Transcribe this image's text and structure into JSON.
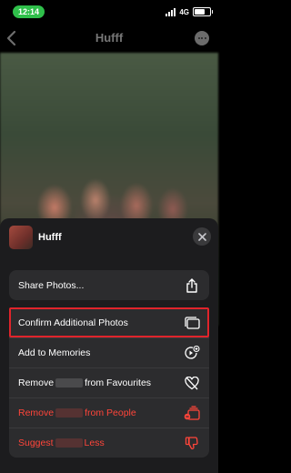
{
  "status": {
    "time": "12:14",
    "network": "4G"
  },
  "nav": {
    "title": "Hufff"
  },
  "sheet": {
    "title": "Hufff",
    "share_label": "Share Photos...",
    "rows": [
      {
        "label": "Confirm Additional Photos",
        "icon": "photo-stack-icon",
        "highlighted": true
      },
      {
        "label": "Add to Memories",
        "icon": "memories-plus-icon"
      },
      {
        "label_before": "Remove",
        "label_after": "from Favourites",
        "icon": "heart-slash-icon"
      },
      {
        "label_before": "Remove",
        "label_after": "from People",
        "icon": "people-remove-icon",
        "destructive": true
      },
      {
        "label_before": "Suggest",
        "label_after": "Less",
        "icon": "thumbs-down-icon",
        "destructive": true
      }
    ]
  },
  "colors": {
    "time_pill": "#2fbf4a",
    "destructive": "#ff453a",
    "highlight": "#e0242b",
    "sheet_bg": "#1c1c1e",
    "row_bg": "#2c2c2e"
  }
}
